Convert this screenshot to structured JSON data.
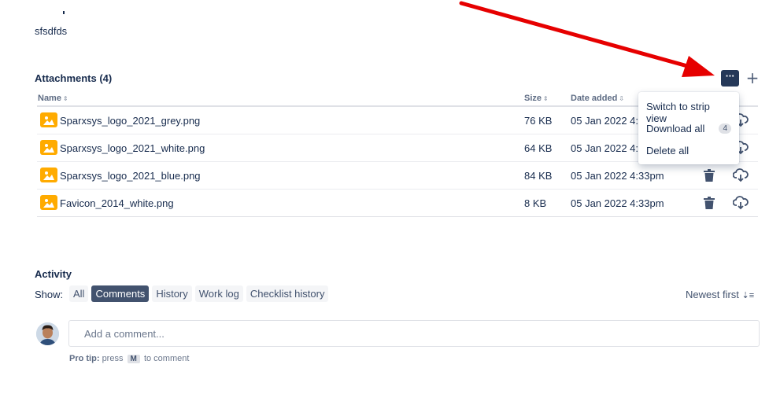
{
  "description": {
    "text": "sfsdfds"
  },
  "attachments": {
    "title": "Attachments (4)",
    "more_label": "···",
    "add_label": "+",
    "columns": {
      "name": "Name",
      "size": "Size",
      "date": "Date added"
    },
    "files": [
      {
        "name": "Sparxsys_logo_2021_grey.png",
        "size": "76 KB",
        "date": "05 Jan 2022 4:33pm"
      },
      {
        "name": "Sparxsys_logo_2021_white.png",
        "size": "64 KB",
        "date": "05 Jan 2022 4:33pm"
      },
      {
        "name": "Sparxsys_logo_2021_blue.png",
        "size": "84 KB",
        "date": "05 Jan 2022 4:33pm"
      },
      {
        "name": "Favicon_2014_white.png",
        "size": "8 KB",
        "date": "05 Jan 2022 4:33pm"
      }
    ]
  },
  "menu": {
    "strip_view": "Switch to strip view",
    "download_all": "Download all",
    "download_count": "4",
    "delete_all": "Delete all"
  },
  "activity": {
    "title": "Activity",
    "show_label": "Show:",
    "filters": [
      "All",
      "Comments",
      "History",
      "Work log",
      "Checklist history"
    ],
    "active_filter": "Comments",
    "sort_label": "Newest first",
    "comment_placeholder": "Add a comment...",
    "protip_label": "Pro tip:",
    "protip_press": "press",
    "protip_key": "M",
    "protip_suffix": "to comment"
  },
  "colors": {
    "accent": "#42526e",
    "file_icon": "#ffab00",
    "annotation_arrow": "#e60000"
  }
}
